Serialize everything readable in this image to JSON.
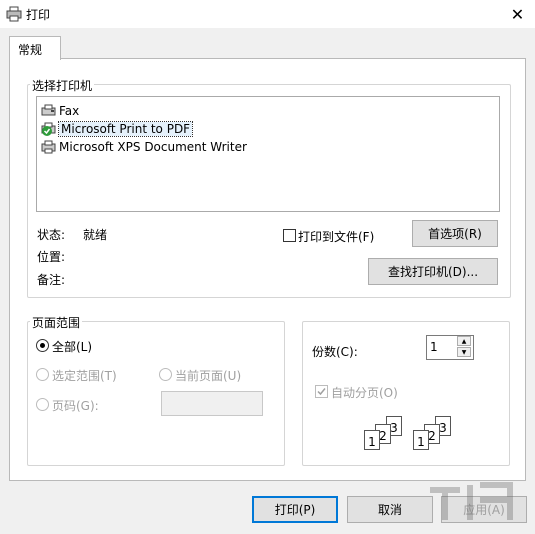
{
  "window": {
    "title": "打印"
  },
  "tabs": [
    {
      "label": "常规"
    }
  ],
  "printer_group": {
    "label": "选择打印机",
    "printers": [
      {
        "name": "Fax"
      },
      {
        "name": "Microsoft Print to PDF",
        "selected": true
      },
      {
        "name": "Microsoft XPS Document Writer"
      }
    ],
    "status_label": "状态:",
    "status_value": "就绪",
    "location_label": "位置:",
    "comment_label": "备注:",
    "print_to_file_label": "打印到文件(F)",
    "print_to_file_checked": false,
    "preferences_button": "首选项(R)",
    "find_printer_button": "查找打印机(D)..."
  },
  "page_range": {
    "label": "页面范围",
    "all_label": "全部(L)",
    "selection_label": "选定范围(T)",
    "current_page_label": "当前页面(U)",
    "pages_label": "页码(G):",
    "pages_value": ""
  },
  "copies": {
    "label": "份数(C):",
    "value": "1",
    "collate_label": "自动分页(O)",
    "collate_checked": true,
    "collate_page_numbers": [
      "1",
      "2",
      "3"
    ]
  },
  "footer": {
    "print_button": "打印(P)",
    "cancel_button": "取消",
    "apply_button": "应用(A)"
  },
  "colors": {
    "accent": "#0078d7",
    "selection_bg": "#e5f1fb",
    "status_ok": "#2e9b3a"
  },
  "icons": {
    "title": "printer-icon",
    "close": "close-icon",
    "printer": "printer-icon"
  }
}
